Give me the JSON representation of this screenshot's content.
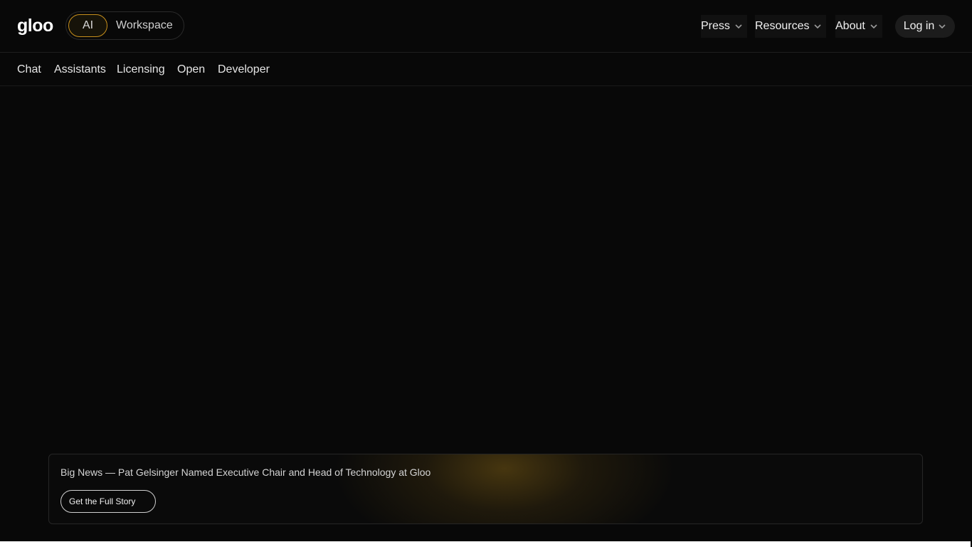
{
  "header": {
    "logo_text": "gloo",
    "mode_toggle": {
      "active": "AI",
      "inactive": "Workspace"
    },
    "nav": [
      {
        "label": "Press"
      },
      {
        "label": "Resources"
      },
      {
        "label": "About"
      }
    ],
    "login_label": "Log in"
  },
  "subnav": {
    "items": [
      "Chat",
      "Assistants",
      "Licensing",
      "Open",
      "Developer"
    ]
  },
  "banner": {
    "text": "Big News — Pat Gelsinger Named Executive Chair and Head of Technology at Gloo",
    "button_label": "Get the Full Story"
  },
  "colors": {
    "background": "#080808",
    "accent_gold": "#c8901c",
    "text": "#e8e8e8"
  },
  "icons": {
    "dropdown": "chevron-down-icon"
  }
}
